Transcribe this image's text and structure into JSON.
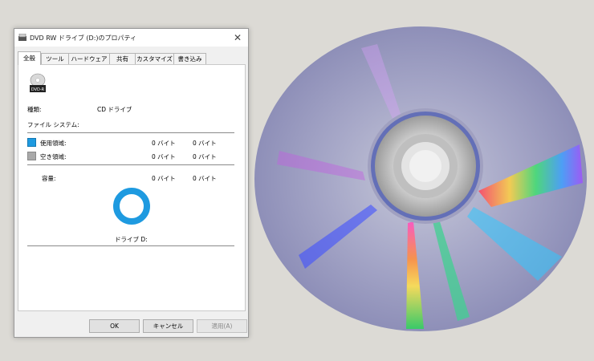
{
  "colors": {
    "used": "#1e9ae0",
    "free": "#a9a9a9",
    "background": "#dcdad5"
  },
  "dialog": {
    "title": "DVD RW ドライブ (D:)のプロパティ",
    "icons": {
      "title": "drive-icon",
      "close": "close-icon",
      "drive": "dvd-r-icon"
    },
    "drive_icon_label": "DVD-R",
    "tabs": [
      "全般",
      "ツール",
      "ハードウェア",
      "共有",
      "カスタマイズ",
      "書き込み"
    ],
    "active_tab": "全般",
    "type_label": "種類:",
    "type_value": "CD ドライブ",
    "filesystem_label": "ファイル システム:",
    "used": {
      "label": "使用領域:",
      "bytes": "0 バイト",
      "size": "0 バイト"
    },
    "free": {
      "label": "空き領域:",
      "bytes": "0 バイト",
      "size": "0 バイト"
    },
    "capacity": {
      "label": "容量:",
      "bytes": "0 バイト",
      "size": "0 バイト"
    },
    "drive_caption": "ドライブ D:",
    "buttons": {
      "ok": "OK",
      "cancel": "キャンセル",
      "apply": "適用(A)"
    }
  }
}
